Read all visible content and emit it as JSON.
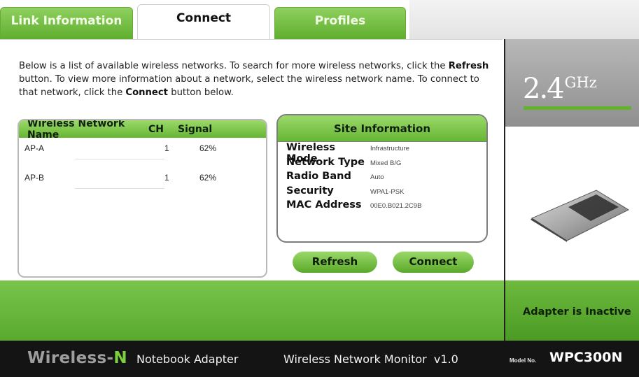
{
  "tabs": [
    {
      "label": "Link Information",
      "active": false
    },
    {
      "label": "Connect",
      "active": true
    },
    {
      "label": "Profiles",
      "active": false
    }
  ],
  "intro": {
    "part1": "Below is a list of available wireless networks. To search for more wireless networks, click the ",
    "refresh_word": "Refresh",
    "part2": " button. To view more information about a network, select the wireless network name. To connect to that network, click the ",
    "connect_word": "Connect",
    "part3": " button below."
  },
  "network_list": {
    "columns": [
      "Wireless Network Name",
      "CH",
      "Signal"
    ],
    "rows": [
      {
        "name": "AP-A",
        "ch": "1",
        "signal": "62%"
      },
      {
        "name": "AP-B",
        "ch": "1",
        "signal": "62%"
      }
    ]
  },
  "site_info": {
    "title": "Site Information",
    "fields": [
      {
        "label": "Wireless Mode",
        "value": "Infrastructure"
      },
      {
        "label": "Network Type",
        "value": "Mixed B/G"
      },
      {
        "label": "Radio Band",
        "value": "Auto"
      },
      {
        "label": "Security",
        "value": "WPA1-PSK"
      },
      {
        "label": "MAC Address",
        "value": "00E0.B021.2C9B"
      }
    ]
  },
  "buttons": {
    "refresh": "Refresh",
    "connect": "Connect"
  },
  "band": {
    "number": "2.4",
    "unit": "GHz"
  },
  "status": {
    "text": "Adapter is Inactive"
  },
  "footer": {
    "brand_wireless": "Wireless-",
    "brand_n": "N",
    "product": "Notebook Adapter",
    "app_name": "Wireless Network Monitor  v1.0",
    "model_label": "Model No.",
    "model": "WPC300N"
  },
  "colors": {
    "accent_green": "#67b634",
    "footer_bg": "#141414",
    "band_gray": "#9f9f9f"
  }
}
